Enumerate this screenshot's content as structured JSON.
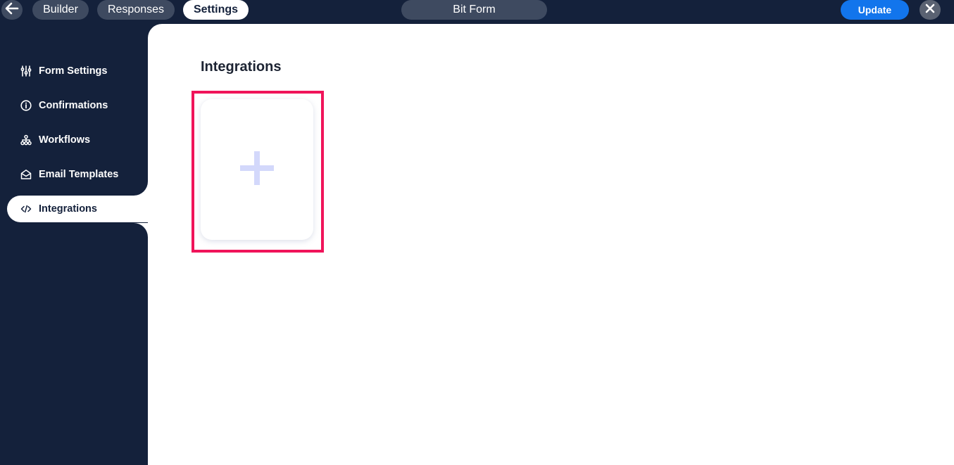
{
  "topbar": {
    "tabs": [
      {
        "label": "Builder"
      },
      {
        "label": "Responses"
      },
      {
        "label": "Settings",
        "active": true
      }
    ],
    "form_title": "Bit Form",
    "update_label": "Update",
    "back_icon": "arrow-left-icon",
    "close_icon": "close-icon"
  },
  "sidebar": {
    "items": [
      {
        "label": "Form Settings",
        "icon": "sliders-icon"
      },
      {
        "label": "Confirmations",
        "icon": "info-icon"
      },
      {
        "label": "Workflows",
        "icon": "hierarchy-icon"
      },
      {
        "label": "Email Templates",
        "icon": "envelope-open-icon"
      },
      {
        "label": "Integrations",
        "icon": "code-icon",
        "active": true
      }
    ]
  },
  "main": {
    "title": "Integrations",
    "add_card_icon": "plus-icon"
  },
  "colors": {
    "sidebar_bg": "#14213b",
    "accent_blue": "#1275ec",
    "highlight": "#f0145a",
    "plus": "#d3d8fb"
  }
}
